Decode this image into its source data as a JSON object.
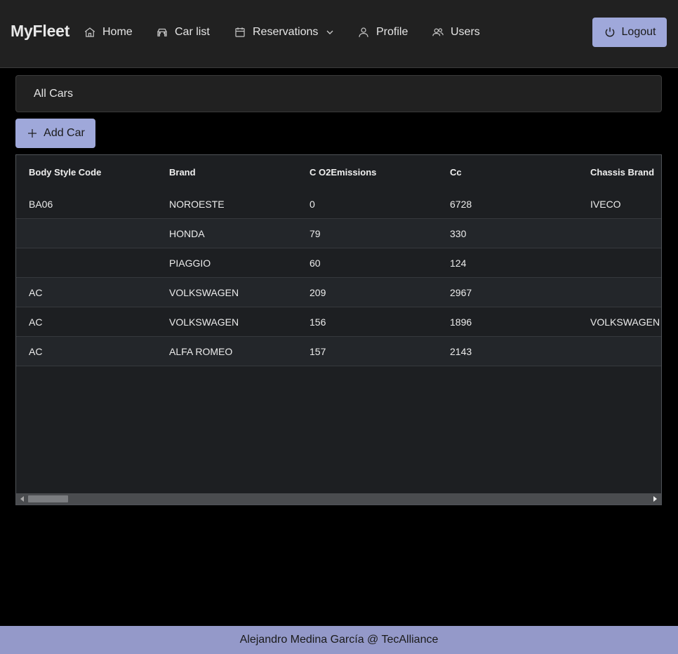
{
  "app": {
    "brand": "MyFleet"
  },
  "nav": {
    "home": {
      "label": "Home",
      "icon": "home-icon"
    },
    "car_list": {
      "label": "Car list",
      "icon": "car-icon"
    },
    "reservations": {
      "label": "Reservations",
      "icon": "calendar-icon"
    },
    "profile": {
      "label": "Profile",
      "icon": "user-icon"
    },
    "users": {
      "label": "Users",
      "icon": "users-icon"
    },
    "logout": {
      "label": "Logout",
      "icon": "power-icon"
    }
  },
  "breadcrumb": {
    "title": "All Cars"
  },
  "toolbar": {
    "add_label": "Add Car",
    "add_icon": "plus-icon"
  },
  "table": {
    "columns": [
      "Body Style Code",
      "Brand",
      "C O2Emissions",
      "Cc",
      "Chassis Brand"
    ],
    "rows": [
      [
        "BA06",
        "NOROESTE",
        "0",
        "6728",
        "IVECO"
      ],
      [
        "",
        "HONDA",
        "79",
        "330",
        ""
      ],
      [
        "",
        "PIAGGIO",
        "60",
        "124",
        ""
      ],
      [
        "AC",
        "VOLKSWAGEN",
        "209",
        "2967",
        ""
      ],
      [
        "AC",
        "VOLKSWAGEN",
        "156",
        "1896",
        "VOLKSWAGEN"
      ],
      [
        "AC",
        "ALFA ROMEO",
        "157",
        "2143",
        ""
      ]
    ]
  },
  "footer": {
    "text": "Alejandro Medina García @ TecAlliance"
  },
  "colors": {
    "accent": "#9fa8da",
    "footer_bg": "#9499c9",
    "navbar_bg": "#212121",
    "page_bg": "#000000",
    "table_bg": "#1d1f22"
  }
}
